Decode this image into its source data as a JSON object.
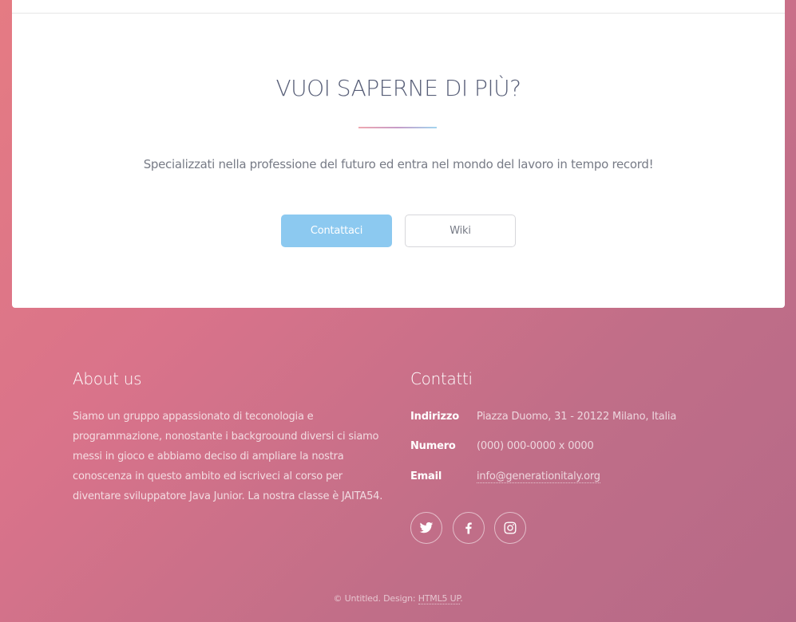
{
  "cta": {
    "title": "VUOI SAPERNE DI PIÙ?",
    "text": "Specializzati nella professione del futuro ed entra nel mondo del lavoro in tempo record!",
    "primary_label": "Contattaci",
    "secondary_label": "Wiki"
  },
  "about": {
    "title": "About us",
    "text": "Siamo un gruppo appassionato di teconologia e programmazione, nonostante i backgroound diversi ci siamo messi in gioco e abbiamo deciso di ampliare la nostra conoscenza in questo ambito ed iscriveci al corso per diventare sviluppatore Java Junior. La nostra classe è JAITA54."
  },
  "contacts": {
    "title": "Contatti",
    "address_label": "Indirizzo",
    "address_value": "Piazza Duomo, 31 - 20122 Milano, Italia",
    "phone_label": "Numero",
    "phone_value": "(000) 000-0000 x 0000",
    "email_label": "Email",
    "email_value": "info@generationitaly.org",
    "socials": [
      "twitter-icon",
      "facebook-icon",
      "instagram-icon"
    ]
  },
  "footer": {
    "copyright_prefix": "© Untitled. Design:",
    "design_link": "HTML5 UP",
    "suffix": "."
  },
  "colors": {
    "primary_button": "#8cc9f0",
    "heading": "#585f78",
    "gradient_start": "#e57b83",
    "gradient_end": "#b66987"
  }
}
